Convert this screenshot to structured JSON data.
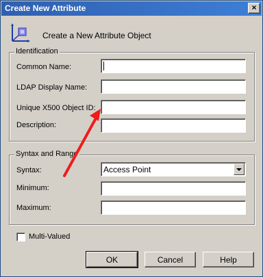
{
  "window": {
    "title": "Create New Attribute",
    "close_glyph": "×"
  },
  "header": {
    "icon": "attribute-object-icon",
    "text": "Create a New Attribute Object"
  },
  "identification": {
    "legend": "Identification",
    "common_name_label": "Common Name:",
    "common_name_value": "",
    "ldap_label": "LDAP Display Name:",
    "ldap_value": "",
    "x500_label": "Unique X500 Object ID:",
    "x500_value": "",
    "description_label": "Description:",
    "description_value": ""
  },
  "syntax_range": {
    "legend": "Syntax and Range",
    "syntax_label": "Syntax:",
    "syntax_selected": "Access Point",
    "minimum_label": "Minimum:",
    "minimum_value": "",
    "maximum_label": "Maximum:",
    "maximum_value": ""
  },
  "multi_valued": {
    "label": "Multi-Valued",
    "checked": false
  },
  "buttons": {
    "ok": "OK",
    "cancel": "Cancel",
    "help": "Help"
  },
  "colors": {
    "annotation_arrow": "#ee1c1c",
    "titlebar": "#2f5fb0",
    "dialog_bg": "#d4d0c8"
  }
}
